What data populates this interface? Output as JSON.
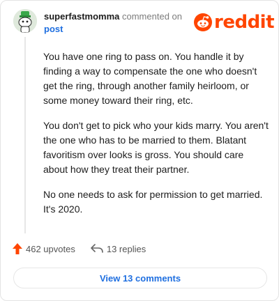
{
  "comment": {
    "username": "superfastmomma",
    "action_text": "commented on",
    "target_link": "post",
    "paragraphs": [
      "You have one ring to pass on. You handle it by finding a way to compensate the one who doesn't get the ring, through another family heirloom, or some money toward their ring, etc.",
      "You don't get to pick who your kids marry. You aren't the one who has to be married to them. Blatant favoritism over looks is gross. You should care about how they treat their partner.",
      "No one needs to ask for permission to get married. It's 2020."
    ]
  },
  "brand": {
    "logo_text": "reddit",
    "color": "#ff4500"
  },
  "actions": {
    "upvotes_label": "462 upvotes",
    "replies_label": "13 replies"
  },
  "view_button": {
    "label": "View 13 comments"
  },
  "colors": {
    "link": "#1f6fe0",
    "upvote": "#ff4500",
    "muted": "#7c7c7c"
  },
  "icons": [
    "avatar",
    "reddit-snoo-icon",
    "upvote-arrow-icon",
    "reply-arrow-icon"
  ]
}
